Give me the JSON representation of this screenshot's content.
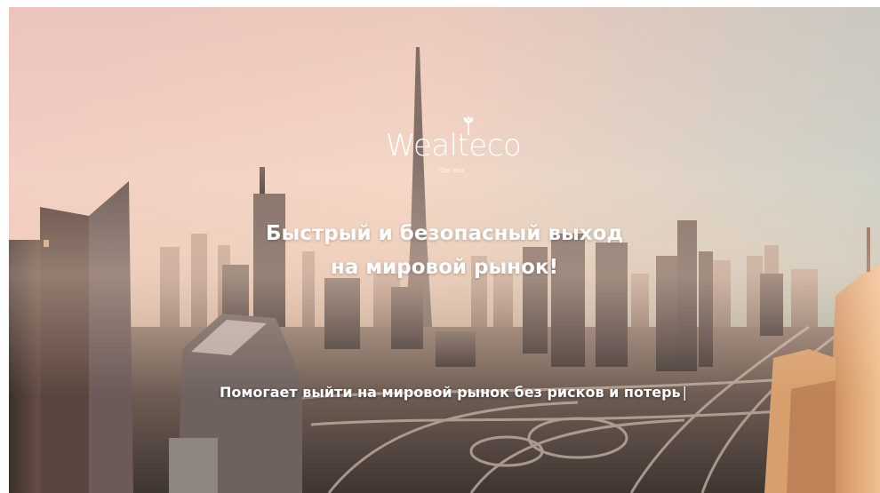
{
  "logo": {
    "wordmark": "Wealteco",
    "tagline": "Get eco"
  },
  "hero": {
    "headline_line1": "Быстрый и безопасный выход",
    "headline_line2": "на мировой рынок!",
    "subheadline": "Помогает выйти на мировой рынок без рисков и потерь",
    "caret": "|"
  },
  "colors": {
    "text": "#ffffff",
    "sky_top": "#e9c7bb",
    "sky_right": "#9cc6c4"
  },
  "icons": {
    "logo_mark": "sprout-icon"
  }
}
